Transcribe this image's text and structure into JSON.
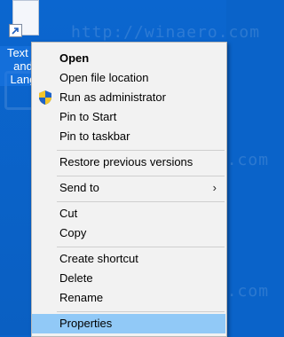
{
  "desktop": {
    "icon_label_lines": [
      "Text S",
      "and",
      "Lang"
    ],
    "watermark_url": "http://winaero.com"
  },
  "menu": {
    "items": [
      {
        "label": "Open"
      },
      {
        "label": "Open file location"
      },
      {
        "label": "Run as administrator"
      },
      {
        "label": "Pin to Start"
      },
      {
        "label": "Pin to taskbar"
      },
      {
        "label": "Restore previous versions"
      },
      {
        "label": "Send to"
      },
      {
        "label": "Cut"
      },
      {
        "label": "Copy"
      },
      {
        "label": "Create shortcut"
      },
      {
        "label": "Delete"
      },
      {
        "label": "Rename"
      },
      {
        "label": "Properties"
      }
    ],
    "submenu_glyph": "›"
  }
}
